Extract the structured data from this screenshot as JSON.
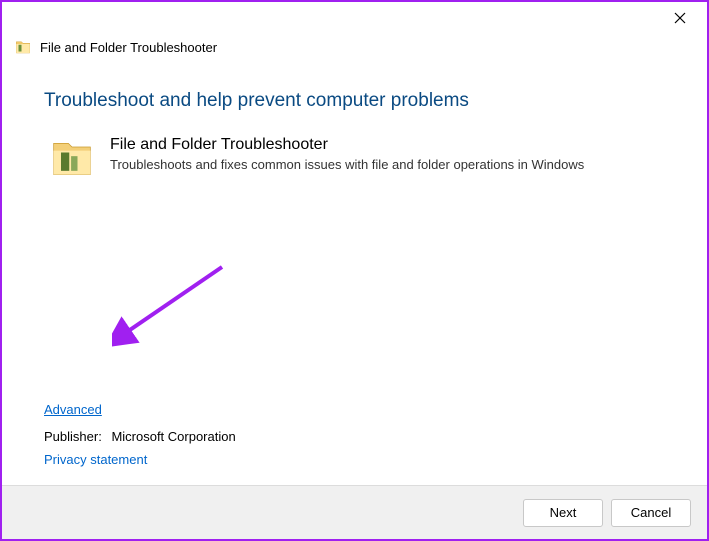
{
  "window": {
    "app_title": "File and Folder Troubleshooter"
  },
  "main": {
    "heading": "Troubleshoot and help prevent computer problems",
    "item": {
      "title": "File and Folder Troubleshooter",
      "description": "Troubleshoots and fixes common issues with file and folder operations in Windows"
    }
  },
  "links": {
    "advanced": "Advanced",
    "privacy": "Privacy statement"
  },
  "publisher": {
    "label": "Publisher:",
    "value": "Microsoft Corporation"
  },
  "footer": {
    "next": "Next",
    "cancel": "Cancel"
  }
}
